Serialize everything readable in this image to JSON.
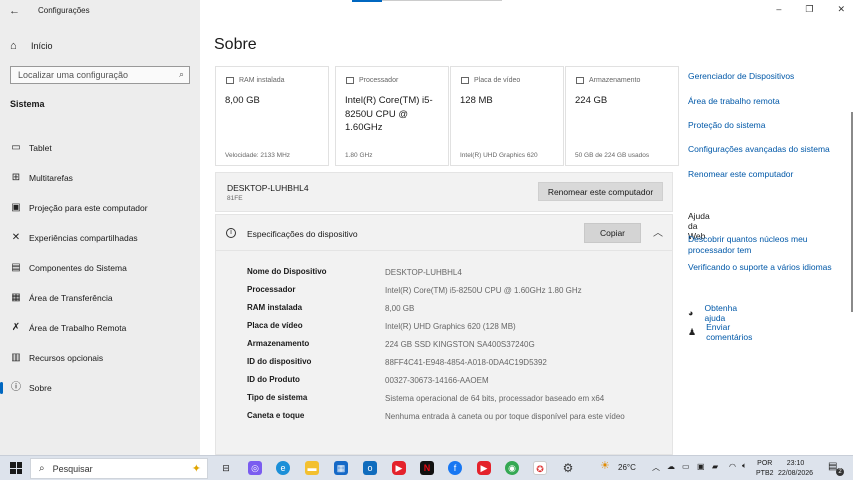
{
  "app": {
    "title": "Configurações"
  },
  "sidebar": {
    "home_label": "Início",
    "search_placeholder": "Localizar uma configuração",
    "section_label": "Sistema",
    "items": [
      {
        "label": "Tablet",
        "icon": "tablet-icon"
      },
      {
        "label": "Multitarefas",
        "icon": "multitask-icon"
      },
      {
        "label": "Projeção para este computador",
        "icon": "projection-icon"
      },
      {
        "label": "Experiências compartilhadas",
        "icon": "shared-icon"
      },
      {
        "label": "Componentes do Sistema",
        "icon": "components-icon"
      },
      {
        "label": "Área de Transferência",
        "icon": "clipboard-icon"
      },
      {
        "label": "Área de Trabalho Remota",
        "icon": "remote-icon"
      },
      {
        "label": "Recursos opcionais",
        "icon": "optional-icon"
      },
      {
        "label": "Sobre",
        "icon": "info-icon"
      }
    ]
  },
  "main": {
    "title": "Sobre",
    "cards": [
      {
        "label": "RAM instalada",
        "value": "8,00 GB",
        "sub": "Velocidade: 2133 MHz"
      },
      {
        "label": "Processador",
        "value": "Intel(R) Core(TM) i5-8250U CPU @ 1.60GHz",
        "sub": "1.80 GHz"
      },
      {
        "label": "Placa de vídeo",
        "value": "128 MB",
        "sub": "Intel(R) UHD Graphics 620"
      },
      {
        "label": "Armazenamento",
        "value": "224 GB",
        "sub": "50 GB de 224 GB usados"
      }
    ],
    "device": {
      "name": "DESKTOP-LUHBHL4",
      "model": "81FE",
      "rename_label": "Renomear este computador"
    },
    "specs": {
      "title": "Especificações do dispositivo",
      "copy_label": "Copiar",
      "rows": [
        {
          "key": "Nome do Dispositivo",
          "value": "DESKTOP-LUHBHL4"
        },
        {
          "key": "Processador",
          "value": "Intel(R) Core(TM) i5-8250U CPU @ 1.60GHz   1.80 GHz"
        },
        {
          "key": "RAM instalada",
          "value": "8,00 GB"
        },
        {
          "key": "Placa de vídeo",
          "value": "Intel(R) UHD Graphics 620 (128 MB)"
        },
        {
          "key": "Armazenamento",
          "value": "224 GB SSD KINGSTON SA400S37240G"
        },
        {
          "key": "ID do dispositivo",
          "value": "88FF4C41-E948-4854-A018-0DA4C19D5392"
        },
        {
          "key": "ID do Produto",
          "value": "00327-30673-14166-AAOEM"
        },
        {
          "key": "Tipo de sistema",
          "value": "Sistema operacional de 64 bits, processador baseado em x64"
        },
        {
          "key": "Caneta e toque",
          "value": "Nenhuma entrada à caneta ou por toque disponível para este vídeo"
        }
      ]
    }
  },
  "related": {
    "links": [
      "Gerenciador de Dispositivos",
      "Área de trabalho remota",
      "Proteção do sistema",
      "Configurações avançadas do sistema",
      "Renomear este computador"
    ],
    "web_help_title": "Ajuda da Web",
    "web_links": [
      "Descobrir quantos núcleos meu",
      "processador tem",
      "Verificando o suporte a vários idiomas"
    ],
    "get_help": "Obtenha ajuda",
    "feedback": "Enviar comentários"
  },
  "taskbar": {
    "search_label": "Pesquisar",
    "weather": "26°C",
    "lang_line1": "POR",
    "lang_line2": "PTB2",
    "time": "23:10",
    "date": "22/08/2026",
    "notification_count": "2"
  }
}
